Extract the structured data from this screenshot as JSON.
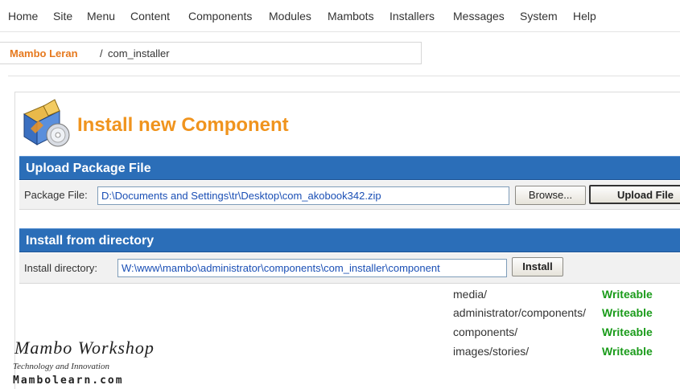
{
  "menu": {
    "items": [
      "Home",
      "Site",
      "Menu",
      "Content",
      "Components",
      "Modules",
      "Mambots",
      "Installers",
      "Messages",
      "System",
      "Help"
    ]
  },
  "breadcrumb": {
    "site": "Mambo Leran",
    "separator": "/",
    "path": "com_installer"
  },
  "page": {
    "title": "Install new Component"
  },
  "upload": {
    "heading": "Upload Package File",
    "label": "Package File:",
    "value": "D:\\Documents and Settings\\tr\\Desktop\\com_akobook342.zip",
    "browse_label": "Browse...",
    "upload_label": "Upload File"
  },
  "install_dir": {
    "heading": "Install from directory",
    "label": "Install directory:",
    "value": "W:\\www\\mambo\\administrator\\components\\com_installer\\component",
    "install_label": "Install"
  },
  "permissions": [
    {
      "path": "media/",
      "status": "Writeable"
    },
    {
      "path": "administrator/components/",
      "status": "Writeable"
    },
    {
      "path": "components/",
      "status": "Writeable"
    },
    {
      "path": "images/stories/",
      "status": "Writeable"
    }
  ],
  "watermark": {
    "line1": "Mambo   Workshop",
    "line2": "Technology and Innovation",
    "line3": "Mambolearn.com"
  },
  "colors": {
    "title_orange": "#f0941e",
    "section_blue": "#2b6eb8",
    "writeable_green": "#1a9b1a",
    "field_text_blue": "#1a4fb5"
  }
}
